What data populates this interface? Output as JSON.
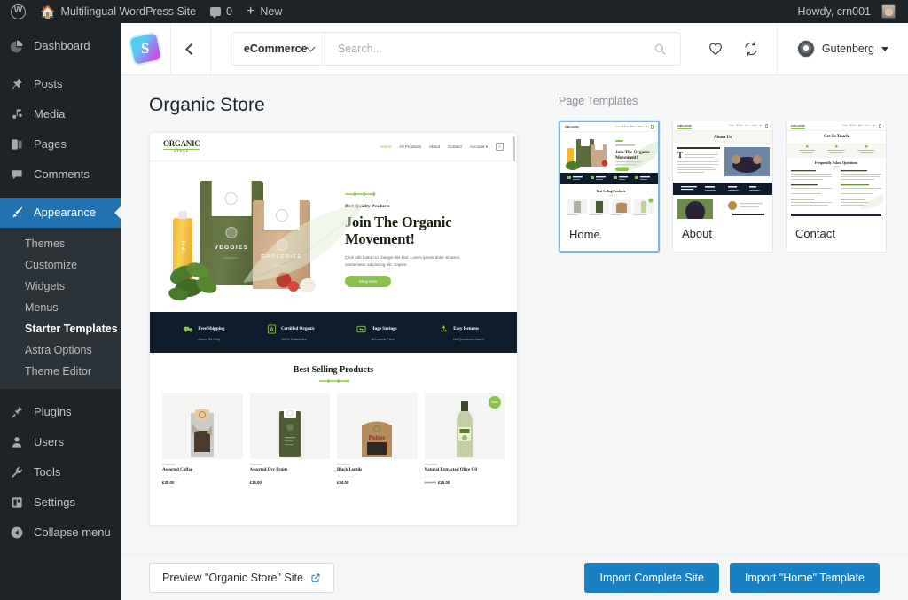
{
  "adminbar": {
    "wp_logo": "wordpress-logo",
    "site_name": "Multilingual WordPress Site",
    "comments_count": "0",
    "new_label": "New",
    "howdy": "Howdy, crn001"
  },
  "adminmenu": {
    "items": [
      {
        "label": "Dashboard",
        "icon": "dashboard-icon",
        "name": "sidebar-item-dashboard"
      },
      {
        "label": "Posts",
        "icon": "pin-icon",
        "name": "sidebar-item-posts"
      },
      {
        "label": "Media",
        "icon": "media-icon",
        "name": "sidebar-item-media"
      },
      {
        "label": "Pages",
        "icon": "pages-icon",
        "name": "sidebar-item-pages"
      },
      {
        "label": "Comments",
        "icon": "comment-icon",
        "name": "sidebar-item-comments"
      },
      {
        "label": "Appearance",
        "icon": "brush-icon",
        "name": "sidebar-item-appearance",
        "current": true
      },
      {
        "label": "Plugins",
        "icon": "plug-icon",
        "name": "sidebar-item-plugins"
      },
      {
        "label": "Users",
        "icon": "user-icon",
        "name": "sidebar-item-users"
      },
      {
        "label": "Tools",
        "icon": "wrench-icon",
        "name": "sidebar-item-tools"
      },
      {
        "label": "Settings",
        "icon": "settings-icon",
        "name": "sidebar-item-settings"
      },
      {
        "label": "Collapse menu",
        "icon": "collapse-icon",
        "name": "sidebar-item-collapse"
      }
    ],
    "appearance_sub": [
      {
        "label": "Themes"
      },
      {
        "label": "Customize"
      },
      {
        "label": "Widgets"
      },
      {
        "label": "Menus"
      },
      {
        "label": "Starter Templates",
        "current": true
      },
      {
        "label": "Astra Options"
      },
      {
        "label": "Theme Editor"
      }
    ]
  },
  "st_header": {
    "logo": "starter-templates-logo",
    "logo_letter": "S",
    "back": "back-chevron-icon",
    "category": "eCommerce",
    "search_placeholder": "Search...",
    "search_value": "",
    "favorites_icon": "heart-icon",
    "refresh_icon": "refresh-icon",
    "page_builder": "Gutenberg"
  },
  "main": {
    "site_title": "Organic Store",
    "page_templates_label": "Page Templates",
    "templates": [
      {
        "name": "Home",
        "selected": true
      },
      {
        "name": "About",
        "selected": false
      },
      {
        "name": "Contact",
        "selected": false
      }
    ]
  },
  "preview": {
    "brand": "ORGANIC",
    "brand_sub": "STORE",
    "nav": [
      "Home",
      "All Products",
      "About",
      "Contact",
      "Account"
    ],
    "cart_icon": "cart-icon",
    "eyebrow": "Best Quality Products",
    "headline": "Join The Organic Movement!",
    "paragraph": "Click edit button to change this text. Lorem ipsum dolor sit amet, consectetur adipiscing elit. Sapien.",
    "cta": "Shop Now",
    "pouch_left": "VEGGIES",
    "pouch_left_sub": "ORGANIC",
    "pouch_right": "GROCERIES",
    "pouch_right_sub": "ORGANIC",
    "bottle_label": "ice.",
    "features": [
      {
        "title": "Free Shipping",
        "sub": "Above $5 Only",
        "icon": "truck-icon"
      },
      {
        "title": "Certified Organic",
        "sub": "100% Guarantee",
        "icon": "certificate-icon"
      },
      {
        "title": "Huge Savings",
        "sub": "At Lowest Price",
        "icon": "savings-icon"
      },
      {
        "title": "Easy Returns",
        "sub": "No Questions Asked",
        "icon": "recycle-icon"
      }
    ],
    "products_title": "Best Selling Products",
    "products": [
      {
        "cat": "Groceries",
        "name": "Assorted Coffee",
        "price": "£35.00",
        "old_price": "",
        "stars": "☆☆☆☆☆",
        "sale": false
      },
      {
        "cat": "Groceries",
        "name": "Assorted Dry Fruits",
        "price": "£15.00",
        "old_price": "",
        "stars": "☆☆☆☆☆",
        "sale": false
      },
      {
        "cat": "Groceries",
        "name": "Black Lentils",
        "price": "£34.00",
        "old_price": "",
        "stars": "☆☆☆☆☆",
        "sale": false
      },
      {
        "cat": "Groceries",
        "name": "Natural Extracted Olive Oil",
        "price": "£25.00",
        "old_price": "£34.00",
        "stars": "☆☆☆☆☆",
        "sale": true,
        "sale_label": "Sale!"
      }
    ]
  },
  "thumbs": {
    "about_title": "About Us",
    "contact_title": "Get In Touch",
    "contact_sub": "Frequently Asked Questions"
  },
  "footer": {
    "preview_label": "Preview \"Organic Store\" Site",
    "external_icon": "external-link-icon",
    "import_site": "Import Complete Site",
    "import_template": "Import \"Home\" Template"
  },
  "colors": {
    "admin_bg": "#1d2327",
    "admin_accent": "#2271b1",
    "button_blue": "#1a80c4",
    "brand_green": "#8bc34a",
    "dark_navy": "#0d1b2a",
    "select_border": "#7eb5e0"
  }
}
